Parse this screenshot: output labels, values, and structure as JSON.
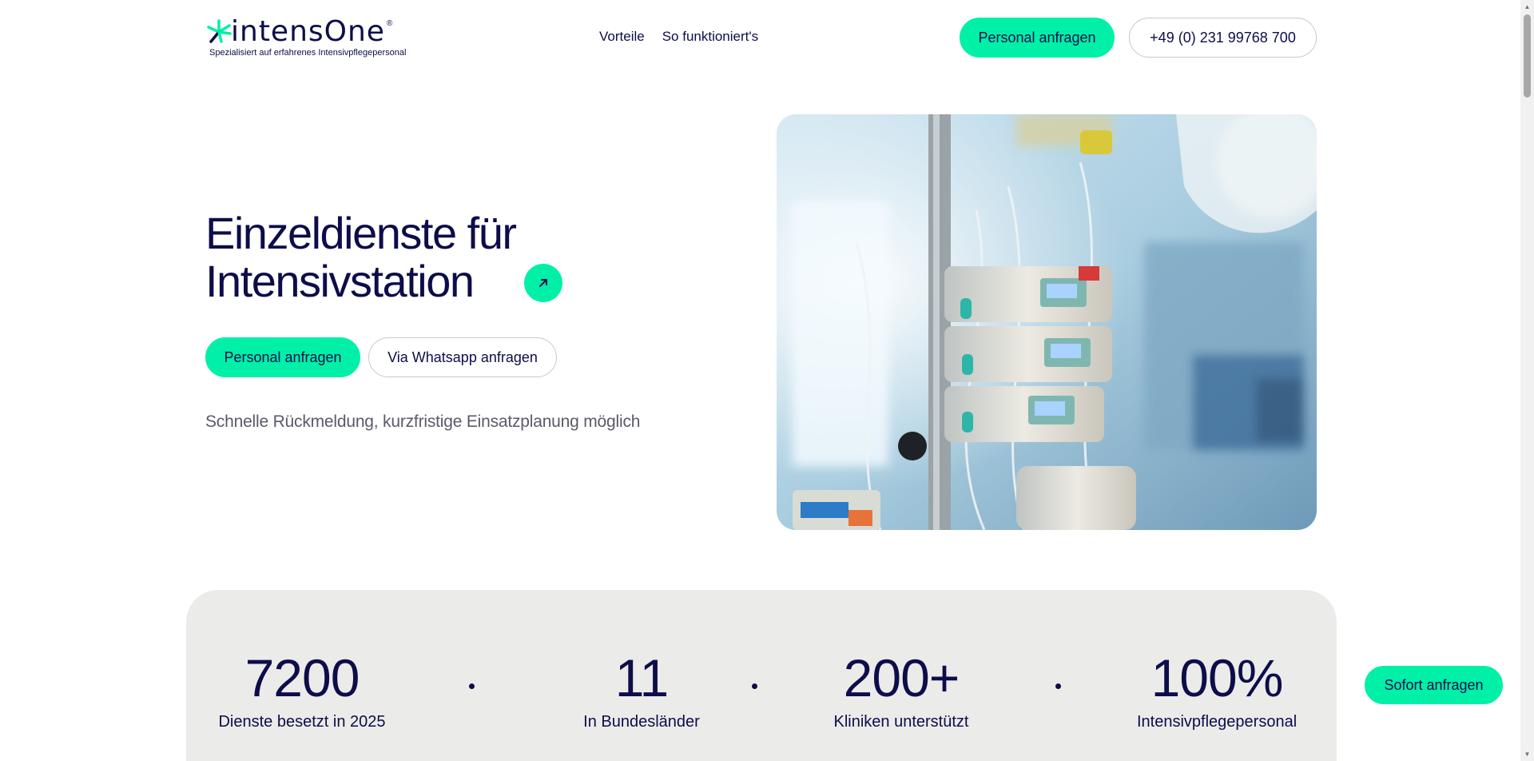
{
  "header": {
    "logo_text": "intensOne",
    "logo_reg": "®",
    "logo_tagline": "Spezialisiert auf erfahrenes Intensivpflegepersonal",
    "nav": [
      {
        "label": "Vorteile"
      },
      {
        "label": "So funktioniert's"
      }
    ],
    "cta_label": "Personal anfragen",
    "phone_label": "+49 (0) 231 99768 700"
  },
  "hero": {
    "title_line1": "Einzeldienste für",
    "title_line2": "Intensivstation",
    "primary_button": "Personal anfragen",
    "secondary_button": "Via Whatsapp anfragen",
    "subtitle": "Schnelle Rückmeldung, kurzfristige Einsatzplanung möglich"
  },
  "stats": [
    {
      "value": "7200",
      "label": "Dienste besetzt in 2025"
    },
    {
      "value": "11",
      "label": "In Bundesländer"
    },
    {
      "value": "200+",
      "label": "Kliniken unterstützt"
    },
    {
      "value": "100%",
      "label": "Intensivpflegepersonal"
    }
  ],
  "floating_cta": "Sofort anfragen",
  "colors": {
    "accent": "#00f0a8",
    "navy": "#0d0d4a",
    "stats_bg": "#ebebea"
  }
}
